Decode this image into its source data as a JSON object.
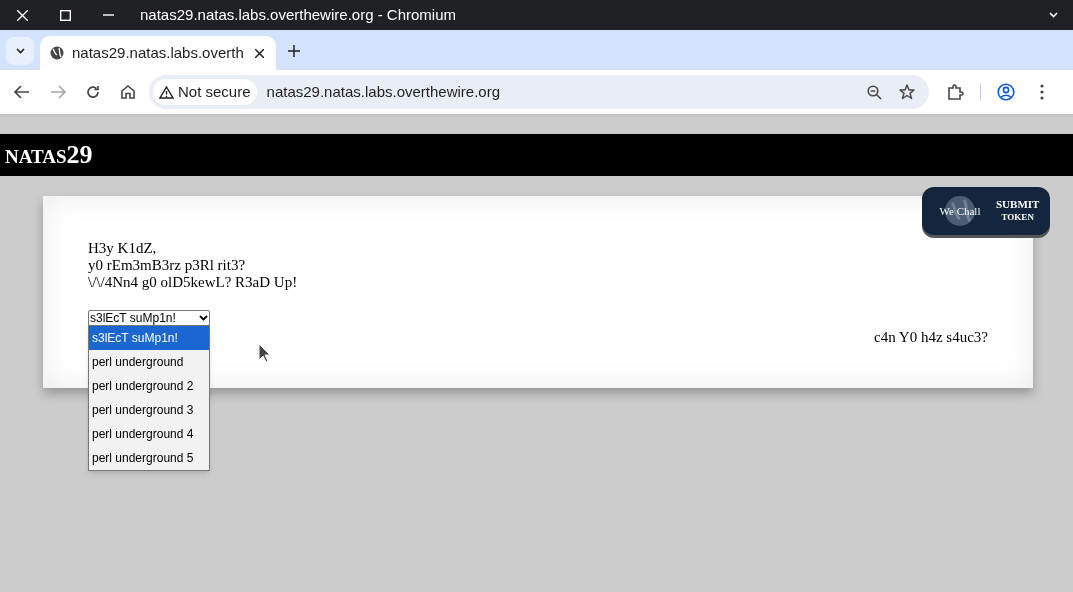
{
  "window": {
    "title": "natas29.natas.labs.overthewire.org - Chromium"
  },
  "tabs": [
    {
      "title": "natas29.natas.labs.overth",
      "selected": true
    }
  ],
  "address_bar": {
    "security": "Not secure",
    "url": "natas29.natas.labs.overthewire.org"
  },
  "page": {
    "header": {
      "prefix": "NATAS",
      "suffix": "29"
    },
    "submit_button": {
      "logo": "We Chall",
      "line_1": "SUBMIT",
      "line_2": "TOKEN"
    },
    "message_lines": [
      "H3y K1dZ,",
      "y0 rEm3mB3rz p3Rl rit3?",
      "\\/\\/4Nn4 g0 olD5kewL? R3aD Up!"
    ],
    "select": {
      "value": "s3lEcT suMp1n!",
      "expanded": true,
      "options": [
        {
          "label": "s3lEcT suMp1n!",
          "selected": true
        },
        {
          "label": "perl underground",
          "selected": false
        },
        {
          "label": "perl underground 2",
          "selected": false
        },
        {
          "label": "perl underground 3",
          "selected": false
        },
        {
          "label": "perl underground 4",
          "selected": false
        },
        {
          "label": "perl underground 5",
          "selected": false
        }
      ]
    },
    "footer_text": "c4n Y0 h4z s4uc3?"
  }
}
